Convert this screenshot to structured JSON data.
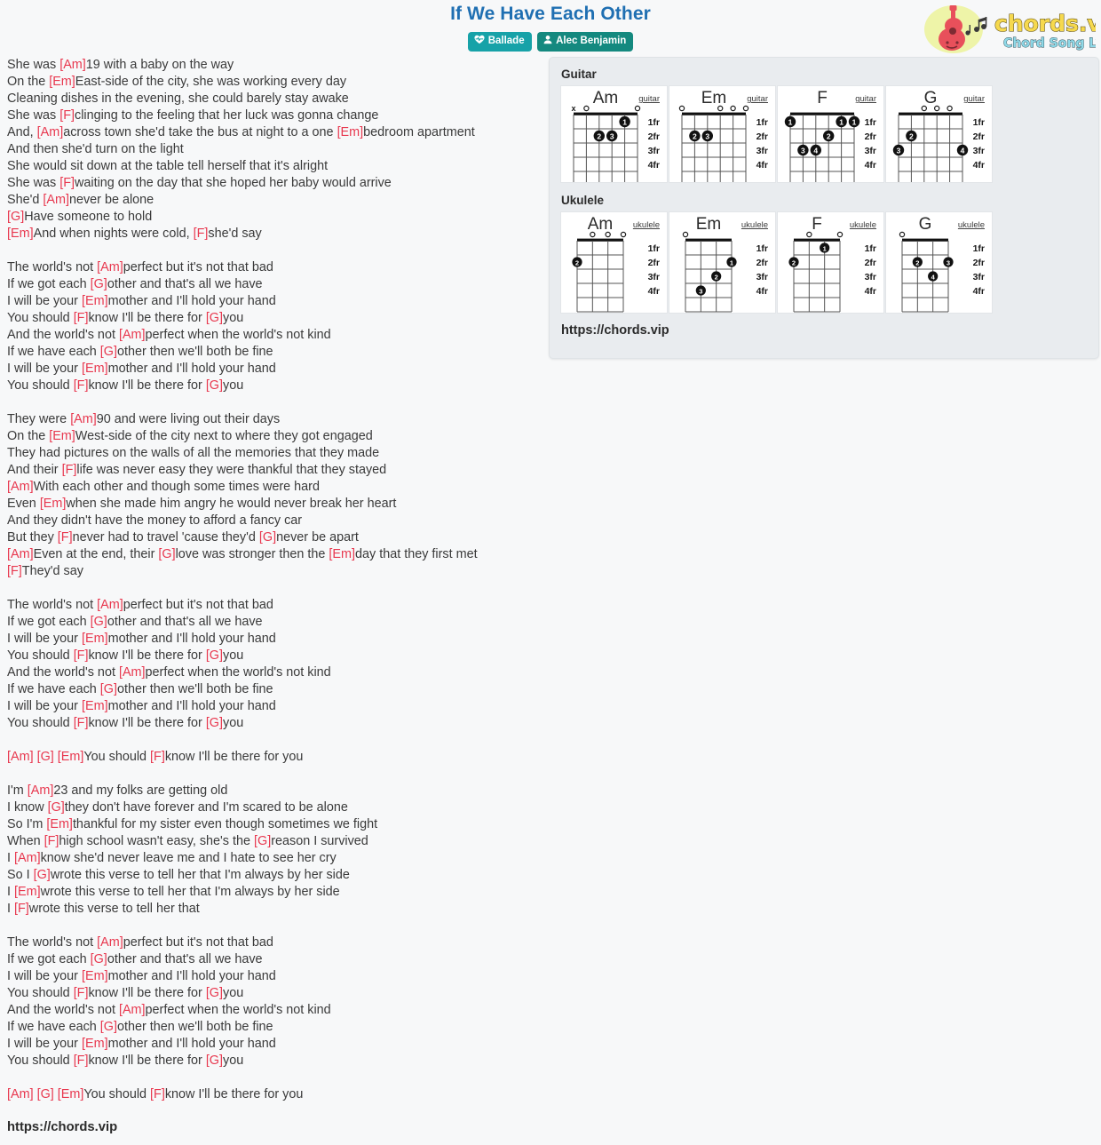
{
  "header": {
    "title": "If We Have Each Other",
    "genre_badge": "Ballade",
    "artist_badge": "Alec Benjamin"
  },
  "logo": {
    "brand": "chords.vip",
    "tagline": "Chord Song Lyric"
  },
  "bottom_url": "https://chords.vip",
  "panel": {
    "guitar_label": "Guitar",
    "ukulele_label": "Ukulele",
    "url": "https://chords.vip",
    "guitar_tag": "guitar",
    "ukulele_tag": "ukulele",
    "frets": [
      "1fr",
      "2fr",
      "3fr",
      "4fr"
    ],
    "guitar_chords": [
      {
        "name": "Am",
        "strings": 6,
        "top": [
          "x",
          "o",
          "",
          "",
          "",
          "o"
        ],
        "dots": [
          {
            "string": 2,
            "fret": 1,
            "finger": "1"
          },
          {
            "string": 4,
            "fret": 2,
            "finger": "2"
          },
          {
            "string": 3,
            "fret": 2,
            "finger": "3"
          }
        ]
      },
      {
        "name": "Em",
        "strings": 6,
        "top": [
          "o",
          "",
          "",
          "o",
          "o",
          "o"
        ],
        "dots": [
          {
            "string": 5,
            "fret": 2,
            "finger": "2"
          },
          {
            "string": 4,
            "fret": 2,
            "finger": "3"
          }
        ]
      },
      {
        "name": "F",
        "strings": 6,
        "top": [
          "",
          "",
          "",
          "",
          "",
          ""
        ],
        "dots": [
          {
            "string": 6,
            "fret": 1,
            "finger": "1"
          },
          {
            "string": 2,
            "fret": 1,
            "finger": "1"
          },
          {
            "string": 1,
            "fret": 1,
            "finger": "1"
          },
          {
            "string": 3,
            "fret": 2,
            "finger": "2"
          },
          {
            "string": 5,
            "fret": 3,
            "finger": "3"
          },
          {
            "string": 4,
            "fret": 3,
            "finger": "4"
          }
        ]
      },
      {
        "name": "G",
        "strings": 6,
        "top": [
          "",
          "",
          "o",
          "o",
          "o",
          ""
        ],
        "dots": [
          {
            "string": 5,
            "fret": 2,
            "finger": "2"
          },
          {
            "string": 6,
            "fret": 3,
            "finger": "3"
          },
          {
            "string": 1,
            "fret": 3,
            "finger": "4"
          }
        ]
      }
    ],
    "ukulele_chords": [
      {
        "name": "Am",
        "strings": 4,
        "top": [
          "",
          "o",
          "o",
          "o"
        ],
        "dots": [
          {
            "string": 4,
            "fret": 2,
            "finger": "2"
          }
        ]
      },
      {
        "name": "Em",
        "strings": 4,
        "top": [
          "o",
          "",
          "",
          ""
        ],
        "dots": [
          {
            "string": 1,
            "fret": 2,
            "finger": "1"
          },
          {
            "string": 2,
            "fret": 3,
            "finger": "2"
          },
          {
            "string": 3,
            "fret": 4,
            "finger": "3"
          }
        ]
      },
      {
        "name": "F",
        "strings": 4,
        "top": [
          "",
          "o",
          "",
          "o"
        ],
        "dots": [
          {
            "string": 2,
            "fret": 1,
            "finger": "1"
          },
          {
            "string": 4,
            "fret": 2,
            "finger": "2"
          }
        ]
      },
      {
        "name": "G",
        "strings": 4,
        "top": [
          "o",
          "",
          "",
          ""
        ],
        "dots": [
          {
            "string": 3,
            "fret": 2,
            "finger": "2"
          },
          {
            "string": 1,
            "fret": 2,
            "finger": "3"
          },
          {
            "string": 2,
            "fret": 3,
            "finger": "4"
          }
        ]
      }
    ]
  },
  "lyrics": [
    [
      [
        {
          "t": "She was "
        },
        {
          "c": "[Am]"
        },
        {
          "t": "19 with a baby on the way"
        }
      ],
      [
        {
          "t": "On the "
        },
        {
          "c": "[Em]"
        },
        {
          "t": "East-side of the city, she was working every day"
        }
      ],
      [
        {
          "t": "Cleaning dishes in the evening, she could barely stay awake"
        }
      ],
      [
        {
          "t": "She was "
        },
        {
          "c": "[F]"
        },
        {
          "t": "clinging to the feeling that her luck was gonna change"
        }
      ],
      [
        {
          "t": "And, "
        },
        {
          "c": "[Am]"
        },
        {
          "t": "across town she'd take the bus at night to a one "
        },
        {
          "c": "[Em]"
        },
        {
          "t": "bedroom apartment"
        }
      ],
      [
        {
          "t": "And then she'd turn on the light"
        }
      ],
      [
        {
          "t": "She would sit down at the table tell herself that it's alright"
        }
      ],
      [
        {
          "t": "She was "
        },
        {
          "c": "[F]"
        },
        {
          "t": "waiting on the day that she hoped her baby would arrive"
        }
      ],
      [
        {
          "t": "She'd "
        },
        {
          "c": "[Am]"
        },
        {
          "t": "never be alone"
        }
      ],
      [
        {
          "c": "[G]"
        },
        {
          "t": "Have someone to hold"
        }
      ],
      [
        {
          "c": "[Em]"
        },
        {
          "t": "And when nights were cold, "
        },
        {
          "c": "[F]"
        },
        {
          "t": "she'd say"
        }
      ]
    ],
    [
      [
        {
          "t": "The world's not "
        },
        {
          "c": "[Am]"
        },
        {
          "t": "perfect but it's not that bad"
        }
      ],
      [
        {
          "t": "If we got each "
        },
        {
          "c": "[G]"
        },
        {
          "t": "other and that's all we have"
        }
      ],
      [
        {
          "t": "I will be your "
        },
        {
          "c": "[Em]"
        },
        {
          "t": "mother and I'll hold your hand"
        }
      ],
      [
        {
          "t": "You should "
        },
        {
          "c": "[F]"
        },
        {
          "t": "know I'll be there for "
        },
        {
          "c": "[G]"
        },
        {
          "t": "you"
        }
      ],
      [
        {
          "t": "And the world's not "
        },
        {
          "c": "[Am]"
        },
        {
          "t": "perfect when the world's not kind"
        }
      ],
      [
        {
          "t": "If we have each "
        },
        {
          "c": "[G]"
        },
        {
          "t": "other then we'll both be fine"
        }
      ],
      [
        {
          "t": "I will be your "
        },
        {
          "c": "[Em]"
        },
        {
          "t": "mother and I'll hold your hand"
        }
      ],
      [
        {
          "t": "You should "
        },
        {
          "c": "[F]"
        },
        {
          "t": "know I'll be there for "
        },
        {
          "c": "[G]"
        },
        {
          "t": "you"
        }
      ]
    ],
    [
      [
        {
          "t": "They were "
        },
        {
          "c": "[Am]"
        },
        {
          "t": "90 and were living out their days"
        }
      ],
      [
        {
          "t": "On the "
        },
        {
          "c": "[Em]"
        },
        {
          "t": "West-side of the city next to where they got engaged"
        }
      ],
      [
        {
          "t": "They had pictures on the walls of all the memories that they made"
        }
      ],
      [
        {
          "t": "And their "
        },
        {
          "c": "[F]"
        },
        {
          "t": "life was never easy they were thankful that they stayed"
        }
      ],
      [
        {
          "c": "[Am]"
        },
        {
          "t": "With each other and though some times were hard"
        }
      ],
      [
        {
          "t": "Even "
        },
        {
          "c": "[Em]"
        },
        {
          "t": "when she made him angry he would never break her heart"
        }
      ],
      [
        {
          "t": "And they didn't have the money to afford a fancy car"
        }
      ],
      [
        {
          "t": "But they "
        },
        {
          "c": "[F]"
        },
        {
          "t": "never had to travel 'cause they'd "
        },
        {
          "c": "[G]"
        },
        {
          "t": "never be apart"
        }
      ],
      [
        {
          "c": "[Am]"
        },
        {
          "t": "Even at the end, their "
        },
        {
          "c": "[G]"
        },
        {
          "t": "love was stronger then the "
        },
        {
          "c": "[Em]"
        },
        {
          "t": "day that they first met"
        }
      ],
      [
        {
          "c": "[F]"
        },
        {
          "t": "They'd say"
        }
      ]
    ],
    [
      [
        {
          "t": "The world's not "
        },
        {
          "c": "[Am]"
        },
        {
          "t": "perfect but it's not that bad"
        }
      ],
      [
        {
          "t": "If we got each "
        },
        {
          "c": "[G]"
        },
        {
          "t": "other and that's all we have"
        }
      ],
      [
        {
          "t": "I will be your "
        },
        {
          "c": "[Em]"
        },
        {
          "t": "mother and I'll hold your hand"
        }
      ],
      [
        {
          "t": "You should "
        },
        {
          "c": "[F]"
        },
        {
          "t": "know I'll be there for "
        },
        {
          "c": "[G]"
        },
        {
          "t": "you"
        }
      ],
      [
        {
          "t": "And the world's not "
        },
        {
          "c": "[Am]"
        },
        {
          "t": "perfect when the world's not kind"
        }
      ],
      [
        {
          "t": "If we have each "
        },
        {
          "c": "[G]"
        },
        {
          "t": "other then we'll both be fine"
        }
      ],
      [
        {
          "t": "I will be your "
        },
        {
          "c": "[Em]"
        },
        {
          "t": "mother and I'll hold your hand"
        }
      ],
      [
        {
          "t": "You should "
        },
        {
          "c": "[F]"
        },
        {
          "t": "know I'll be there for "
        },
        {
          "c": "[G]"
        },
        {
          "t": "you"
        }
      ]
    ],
    [
      [
        {
          "c": "[Am] [G] [Em]"
        },
        {
          "t": "You should "
        },
        {
          "c": "[F]"
        },
        {
          "t": "know I'll be there for you"
        }
      ]
    ],
    [
      [
        {
          "t": "I'm "
        },
        {
          "c": "[Am]"
        },
        {
          "t": "23 and my folks are getting old"
        }
      ],
      [
        {
          "t": "I know "
        },
        {
          "c": "[G]"
        },
        {
          "t": "they don't have forever and I'm scared to be alone"
        }
      ],
      [
        {
          "t": "So I'm "
        },
        {
          "c": "[Em]"
        },
        {
          "t": "thankful for my sister even though sometimes we fight"
        }
      ],
      [
        {
          "t": "When "
        },
        {
          "c": "[F]"
        },
        {
          "t": "high school wasn't easy, she's the "
        },
        {
          "c": "[G]"
        },
        {
          "t": "reason I survived"
        }
      ],
      [
        {
          "t": "I "
        },
        {
          "c": "[Am]"
        },
        {
          "t": "know she'd never leave me and I hate to see her cry"
        }
      ],
      [
        {
          "t": "So I "
        },
        {
          "c": "[G]"
        },
        {
          "t": "wrote this verse to tell her that I'm always by her side"
        }
      ],
      [
        {
          "t": "I "
        },
        {
          "c": "[Em]"
        },
        {
          "t": "wrote this verse to tell her that I'm always by her side"
        }
      ],
      [
        {
          "t": "I "
        },
        {
          "c": "[F]"
        },
        {
          "t": "wrote this verse to tell her that"
        }
      ]
    ],
    [
      [
        {
          "t": "The world's not "
        },
        {
          "c": "[Am]"
        },
        {
          "t": "perfect but it's not that bad"
        }
      ],
      [
        {
          "t": "If we got each "
        },
        {
          "c": "[G]"
        },
        {
          "t": "other and that's all we have"
        }
      ],
      [
        {
          "t": "I will be your "
        },
        {
          "c": "[Em]"
        },
        {
          "t": "mother and I'll hold your hand"
        }
      ],
      [
        {
          "t": "You should "
        },
        {
          "c": "[F]"
        },
        {
          "t": "know I'll be there for "
        },
        {
          "c": "[G]"
        },
        {
          "t": "you"
        }
      ],
      [
        {
          "t": "And the world's not "
        },
        {
          "c": "[Am]"
        },
        {
          "t": "perfect when the world's not kind"
        }
      ],
      [
        {
          "t": "If we have each "
        },
        {
          "c": "[G]"
        },
        {
          "t": "other then we'll both be fine"
        }
      ],
      [
        {
          "t": "I will be your "
        },
        {
          "c": "[Em]"
        },
        {
          "t": "mother and I'll hold your hand"
        }
      ],
      [
        {
          "t": "You should "
        },
        {
          "c": "[F]"
        },
        {
          "t": "know I'll be there for "
        },
        {
          "c": "[G]"
        },
        {
          "t": "you"
        }
      ]
    ],
    [
      [
        {
          "c": "[Am] [G] [Em]"
        },
        {
          "t": "You should "
        },
        {
          "c": "[F]"
        },
        {
          "t": "know I'll be there for you"
        }
      ]
    ]
  ],
  "colors": {
    "title": "#1f6fb2",
    "chord_marker": "#e8384f",
    "genre_badge": "#17a2a8",
    "artist_badge": "#14897f",
    "panel_bg": "#e9ecef"
  }
}
